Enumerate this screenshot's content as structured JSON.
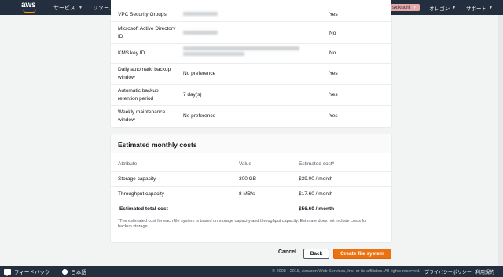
{
  "nav": {
    "logo": "aws",
    "services": "サービス",
    "resource_groups": "リソースグループ",
    "user": "skikuchi",
    "region": "オレゴン",
    "support": "サポート"
  },
  "details": {
    "rows": [
      {
        "label": "VPC Security Groups",
        "value": "",
        "editable": "Yes"
      },
      {
        "label": "Microsoft Active Directory ID",
        "value": "",
        "editable": "No"
      },
      {
        "label": "KMS key ID",
        "value": "",
        "editable": "No"
      },
      {
        "label": "Daily automatic backup window",
        "value": "No preference",
        "editable": "Yes"
      },
      {
        "label": "Automatic backup retention period",
        "value": "7 day(s)",
        "editable": "Yes"
      },
      {
        "label": "Weekly maintenance window",
        "value": "No preference",
        "editable": "Yes"
      }
    ]
  },
  "costs": {
    "title": "Estimated monthly costs",
    "headers": [
      "Attribute",
      "Value",
      "Estimated cost*"
    ],
    "rows": [
      [
        "Storage capacity",
        "300 GB",
        "$39.00 / month"
      ],
      [
        "Throughput capacity",
        "8 MB/s",
        "$17.60 / month"
      ]
    ],
    "total": [
      "Estimated total cost",
      "",
      "$56.60 / month"
    ],
    "note": "*The estimated cost for each file system is based on storage capacity and throughput capacity. Estimate does not include costs for backup storage."
  },
  "actions": {
    "cancel": "Cancel",
    "back": "Back",
    "create": "Create file system"
  },
  "footer": {
    "feedback": "フィードバック",
    "language": "日本語",
    "copyright": "© 2008 - 2018, Amazon Web Services, Inc. or its affiliates. All rights reserved.",
    "privacy": "プライバシーポリシー",
    "terms": "利用規約"
  },
  "colors": {
    "nav_bg": "#232f3e",
    "primary_button": "#ec7211",
    "logo_accent": "#ff9900"
  }
}
